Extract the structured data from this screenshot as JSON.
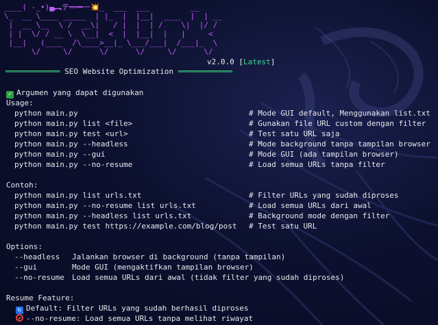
{
  "banner": {
    "ascii_lines": [
      "____( -_•)▄︻テ══━一💥_  ___  ___         __",
      "\\_  __ \\____ _____  | |_  |  |__|  ____  |  | __",
      " |  __ \\__  \\ /  __\\|   / |  |  | /    \\|  |/ /",
      " | |  \\/ / __ \\  \\__|  <  |  |__|  |   |     <",
      " |__|   (____  /\\____>__|_ \\___/___|  /___|_  \\",
      "      \\/     \\/      \\/      \\/     \\/      \\/"
    ],
    "version": "v2.0.0",
    "latest_label": "Latest"
  },
  "section_title": "SEO Website Optimization",
  "args_heading": "Argumen yang dapat digunakan",
  "usage": {
    "heading": "Usage:",
    "rows": [
      {
        "cmd": "python main.py",
        "comment": "# Mode GUI default, Menggunakan list.txt"
      },
      {
        "cmd": "python main.py list <file>",
        "comment": "# Gunakan file URL custom dengan filter"
      },
      {
        "cmd": "python main.py test <url>",
        "comment": "# Test satu URL saja"
      },
      {
        "cmd": "python main.py --headless",
        "comment": "# Mode background tanpa tampilan browser"
      },
      {
        "cmd": "python main.py --gui",
        "comment": "# Mode GUI (ada tampilan browser)"
      },
      {
        "cmd": "python main.py --no-resume",
        "comment": "# Load semua URLs tanpa filter"
      }
    ]
  },
  "contoh": {
    "heading": "Contoh:",
    "rows": [
      {
        "cmd": "python main.py list urls.txt",
        "comment": "# Filter URLs yang sudah diproses"
      },
      {
        "cmd": "python main.py --no-resume list urls.txt",
        "comment": "# Load semua URLs dari awal"
      },
      {
        "cmd": "python main.py --headless list urls.txt",
        "comment": "# Background mode dengan filter"
      },
      {
        "cmd": "python main.py test https://example.com/blog/post",
        "comment": "# Test satu URL"
      }
    ]
  },
  "options": {
    "heading": "Options:",
    "rows": [
      {
        "flag": "--headless",
        "desc": "Jalankan browser di background (tanpa tampilan)"
      },
      {
        "flag": "--gui",
        "desc": "Mode GUI (mengaktifkan tampilan browser)"
      },
      {
        "flag": "--no-resume",
        "desc": "Load semua URLs dari awal (tidak filter yang sudah diproses)"
      }
    ]
  },
  "resume": {
    "heading": "Resume Feature:",
    "default_line": "Default: Filter URLs yang sudah berhasil diproses",
    "noresume_line": "--no-resume: Load semua URLs tanpa melihat riwayat"
  },
  "colors": {
    "background": "#0b0f2a",
    "text": "#e8e8ee",
    "ascii": "#c65cff",
    "accent_green": "#3ddc84",
    "check_green": "#2ea043",
    "info_blue": "#1f6feb",
    "deny_red": "#e0443c"
  },
  "icons": [
    "check-mark-icon",
    "info-square-icon",
    "no-entry-icon"
  ]
}
